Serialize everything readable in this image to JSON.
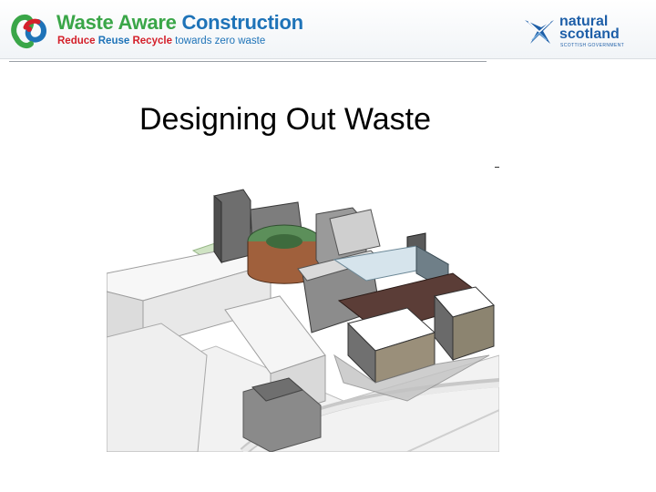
{
  "header": {
    "logo_left": {
      "title_part1": "Waste Aware",
      "title_part2": "Construction",
      "tag_reduce": "Reduce",
      "tag_reuse": "Reuse",
      "tag_recycle": "Recycle",
      "tag_rest": "towards zero waste",
      "icon": "recycle-loop-icon"
    },
    "logo_right": {
      "line1": "natural",
      "line2": "scotland",
      "line3": "SCOTTISH GOVERNMENT",
      "icon": "saltire-bird-icon"
    }
  },
  "slide": {
    "title": "Designing Out Waste"
  },
  "colors": {
    "green": "#3aa648",
    "blue": "#1e73b8",
    "red": "#d4202a",
    "ns_blue": "#1e5fa8"
  }
}
